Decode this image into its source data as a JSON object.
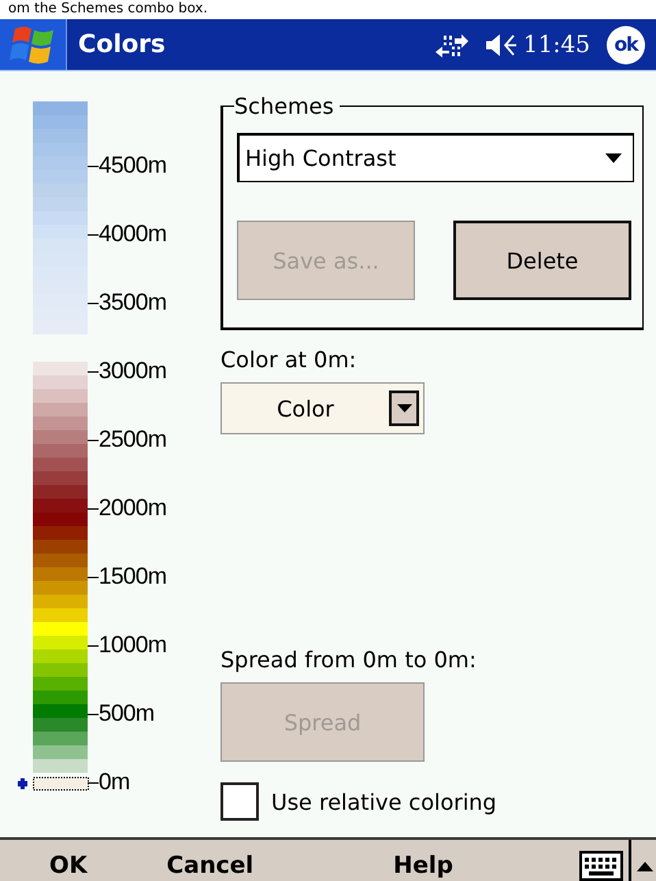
{
  "caption": "om the Schemes combo box.",
  "title_bar": {
    "title": "Colors",
    "time": "11:45",
    "ok_button": "ok"
  },
  "color_scale": {
    "upper_swatches": [
      {
        "color": "#8fb4e3"
      },
      {
        "color": "#98bae6"
      },
      {
        "color": "#a1c0e8"
      },
      {
        "color": "#a8c5ea"
      },
      {
        "color": "#b0caec"
      },
      {
        "color": "#b5cdec"
      },
      {
        "color": "#bcd1ea"
      },
      {
        "color": "#c2d5ee"
      },
      {
        "color": "#c8daf4"
      },
      {
        "color": "#d0e0f5"
      },
      {
        "color": "#d8e5f5"
      },
      {
        "color": "#dae6f5"
      },
      {
        "color": "#dde8f6"
      },
      {
        "color": "#dfe9f6"
      },
      {
        "color": "#e1eaf6"
      },
      {
        "color": "#e3ebf6"
      },
      {
        "color": "#e5ecf6"
      }
    ],
    "lower_swatches": [
      {
        "color": "#eee4e4"
      },
      {
        "color": "#e6d2d2"
      },
      {
        "color": "#dcc0c0"
      },
      {
        "color": "#cfa8a8"
      },
      {
        "color": "#c49494"
      },
      {
        "color": "#b87e7e"
      },
      {
        "color": "#ac6868"
      },
      {
        "color": "#a25252"
      },
      {
        "color": "#983c3c"
      },
      {
        "color": "#8e2626"
      },
      {
        "color": "#881010"
      },
      {
        "color": "#860606"
      },
      {
        "color": "#902000"
      },
      {
        "color": "#9c4000"
      },
      {
        "color": "#ac5c00"
      },
      {
        "color": "#bc7800"
      },
      {
        "color": "#cc9400"
      },
      {
        "color": "#dcb000"
      },
      {
        "color": "#ecd000"
      },
      {
        "color": "#ffff00"
      },
      {
        "color": "#d6ec00"
      },
      {
        "color": "#acd800"
      },
      {
        "color": "#84c400"
      },
      {
        "color": "#58b000"
      },
      {
        "color": "#2c9a00"
      },
      {
        "color": "#007c00"
      },
      {
        "color": "#2a8a2a"
      },
      {
        "color": "#5aa65a"
      },
      {
        "color": "#90c290"
      },
      {
        "color": "#c8dcc8"
      }
    ],
    "ticks": [
      "4500m",
      "4000m",
      "3500m",
      "3000m",
      "2500m",
      "2000m",
      "1500m",
      "1000m",
      "500m",
      "0m"
    ]
  },
  "schemes": {
    "label": "Schemes",
    "combo": {
      "value": "High Contrast"
    },
    "buttons": [
      {
        "label": "Save as...",
        "disabled": true
      },
      {
        "label": "Delete",
        "disabled": false
      }
    ]
  },
  "color_at": {
    "label": "Color at 0m:",
    "dropdown": {
      "value": "Color"
    }
  },
  "spread": {
    "label": "Spread from 0m to 0m:",
    "button": {
      "label": "Spread",
      "disabled": true
    }
  },
  "relative_coloring": {
    "label": "Use relative coloring",
    "checked": false
  },
  "menu_bar": [
    "OK",
    "Cancel",
    "Help"
  ]
}
